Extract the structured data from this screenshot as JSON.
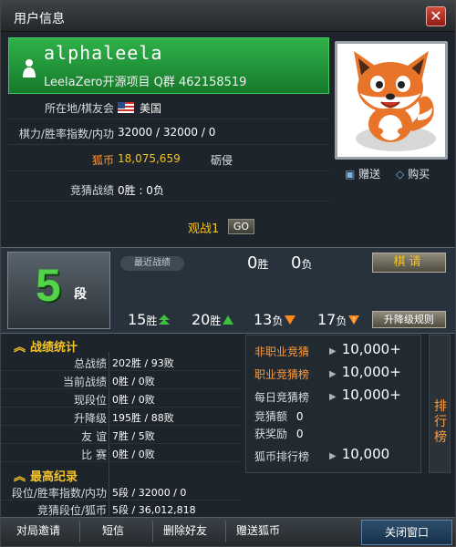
{
  "window": {
    "title": "用户信息",
    "close_glyph": "✕"
  },
  "profile": {
    "name": "alphaleela",
    "subtitle": "LeelaZero开源项目  Q群 462158519",
    "avatar_icon": "fox-icon"
  },
  "avatar_actions": {
    "gift": "赠送",
    "buy": "购买"
  },
  "info": [
    {
      "label": "所在地/棋友会",
      "value": "美国"
    },
    {
      "label": "棋力/胜率指数/内功",
      "value": "32000 / 32000 / 0"
    },
    {
      "label": "狐币",
      "value": "18,075,659"
    },
    {
      "label": "竞猜战绩",
      "value": "0胜 : 0负"
    }
  ],
  "coin_tag": "砺侵",
  "watch": {
    "label": "观战1",
    "go": "GO"
  },
  "rank": {
    "number": "5",
    "unit": "段"
  },
  "recent": {
    "label": "最近战绩",
    "wins": "0",
    "wins_unit": "胜",
    "losses": "0",
    "losses_unit": "负",
    "challenge": "棋请"
  },
  "streaks": [
    {
      "count": "15",
      "unit": "胜",
      "icon": "up-double-green-icon"
    },
    {
      "count": "20",
      "unit": "胜",
      "icon": "up-green-icon"
    },
    {
      "count": "13",
      "unit": "负",
      "icon": "down-orange-icon"
    },
    {
      "count": "17",
      "unit": "负",
      "icon": "question-orange-icon"
    }
  ],
  "rules_button": "升降级规则",
  "stats": {
    "header": "战绩统计",
    "rows": [
      {
        "label": "总战绩",
        "value": "202胜 / 93败"
      },
      {
        "label": "当前战绩",
        "value": "0胜 / 0败"
      },
      {
        "label": "现段位",
        "value": "0胜 / 0败"
      },
      {
        "label": "升降级",
        "value": "195胜 / 88败"
      },
      {
        "label": "友 谊",
        "value": "7胜 / 5败"
      },
      {
        "label": "比 赛",
        "value": "0胜 / 0败"
      }
    ]
  },
  "best": {
    "header": "最高纪录",
    "rows": [
      {
        "label": "段位/胜率指数/内功",
        "value": "5段 / 32000 / 0"
      },
      {
        "label": "竞猜段位/狐币",
        "value": "5段 / 36,012,818"
      }
    ]
  },
  "guess": {
    "rows": [
      {
        "label": "非职业竞猜",
        "value": "10,000+",
        "highlight": true
      },
      {
        "label": "职业竞猜榜",
        "value": "10,000+",
        "highlight": true
      },
      {
        "label": "每日竞猜榜",
        "value": "10,000+",
        "highlight": false
      },
      {
        "label": "竞猜额",
        "value": "0",
        "highlight": false
      },
      {
        "label": "获奖励",
        "value": "0",
        "highlight": false
      },
      {
        "label": "狐币排行榜",
        "value": "10,000",
        "highlight": false
      }
    ],
    "leaderboard": "排行榜"
  },
  "bottom": {
    "invite": "对局邀请",
    "message": "短信",
    "remove_friend": "删除好友",
    "gift_coins": "赠送狐币",
    "close": "关闭窗口"
  },
  "colors": {
    "accent_gold": "#f3c327",
    "accent_orange": "#ff9a3a",
    "rank_green": "#52d34a",
    "header_green": "#1f9a3a"
  }
}
